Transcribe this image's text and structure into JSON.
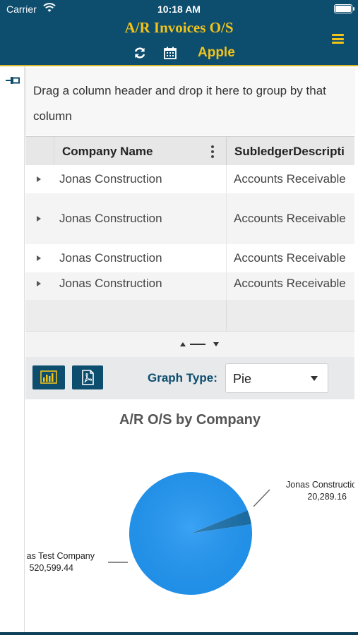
{
  "status_bar": {
    "carrier": "Carrier",
    "time": "10:18 AM"
  },
  "header": {
    "title": "A/R Invoices O/S",
    "company": "Apple",
    "icons": [
      "refresh-icon",
      "calendar-icon",
      "hamburger-menu-icon"
    ],
    "accent": "#f2c319",
    "background": "#0d4d6e"
  },
  "group_panel": {
    "text": "Drag a column header and drop it here to group by that column",
    "icon": "pin-icon"
  },
  "grid": {
    "columns": [
      "Company Name",
      "SubledgerDescripti"
    ],
    "rows": [
      {
        "company": "Jonas Construction",
        "subledger": "Accounts Receivable"
      },
      {
        "company": "Jonas Construction",
        "subledger": "Accounts Receivable"
      },
      {
        "company": "Jonas Construction",
        "subledger": "Accounts Receivable"
      },
      {
        "company": "Jonas Construction",
        "subledger": "Accounts Receivable"
      }
    ]
  },
  "toolbar": {
    "graph_type_label": "Graph Type:",
    "graph_type_value": "Pie",
    "icons": [
      "bar-chart-icon",
      "pdf-icon"
    ]
  },
  "chart_data": {
    "type": "pie",
    "title": "A/R O/S by Company",
    "categories": [
      "Jonas Construction",
      "Jonas Test Company"
    ],
    "values": [
      20289.16,
      520599.44
    ],
    "labels_visible": [
      "Jonas Constructio",
      "as Test Company"
    ],
    "value_labels": [
      "20,289.16",
      "520,599.44"
    ],
    "colors": [
      "#1a6fa8",
      "#2196f3"
    ]
  }
}
